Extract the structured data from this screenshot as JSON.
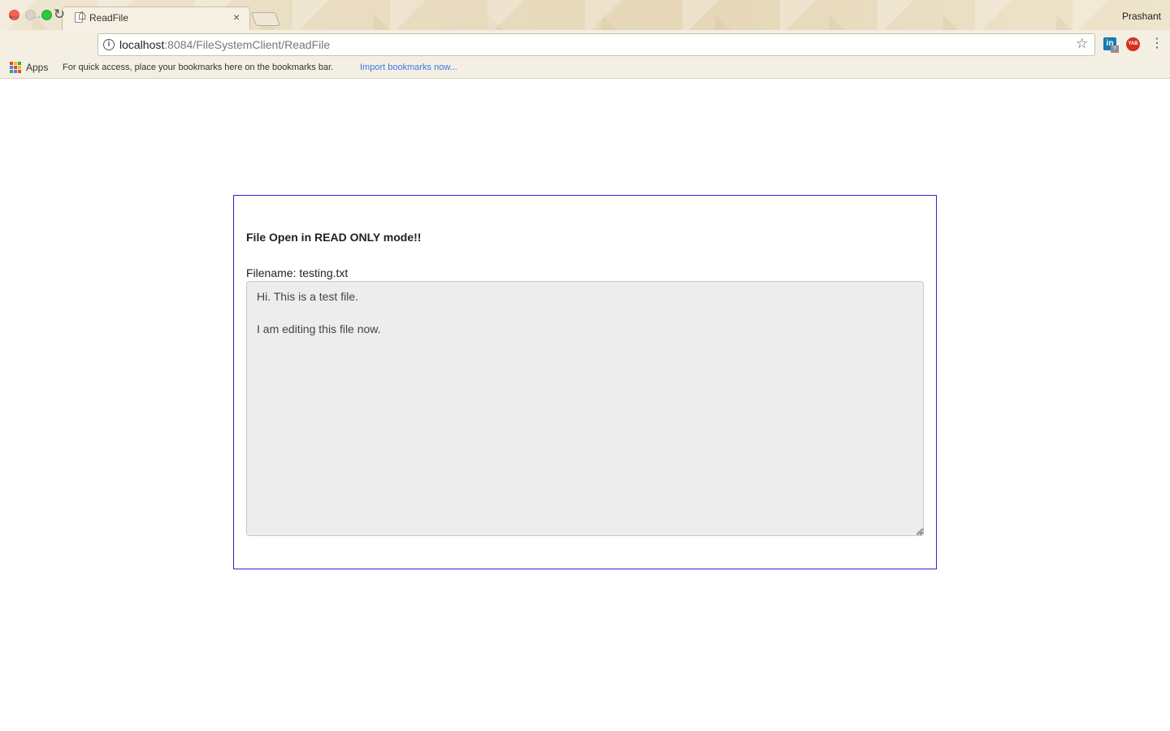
{
  "browser": {
    "tab_title": "ReadFile",
    "tab_close": "×",
    "profile_name": "Prashant",
    "url_host": "localhost",
    "url_rest": ":8084/FileSystemClient/ReadFile",
    "nav": {
      "back_icon": "←",
      "forward_icon": "→",
      "reload_icon": "↻",
      "home_icon": "⌂",
      "info_icon": "i",
      "star_icon": "☆",
      "menu_icon": "⋮"
    },
    "extensions": {
      "linkedin_label": "in",
      "linkedin_badge": "?",
      "yab_label": "YAB"
    },
    "bookmarks_bar": {
      "apps_label": "Apps",
      "hint": "For quick access, place your bookmarks here on the bookmarks bar.",
      "import_link": "Import bookmarks now..."
    }
  },
  "page": {
    "heading": "File Open in READ ONLY mode!!",
    "filename_label": "Filename: testing.txt",
    "file_content": "Hi. This is a test file.\n\nI am editing this file now."
  },
  "colors": {
    "panel_border": "#3a1ad6",
    "textarea_bg": "#ededed",
    "link": "#3b78e7"
  }
}
